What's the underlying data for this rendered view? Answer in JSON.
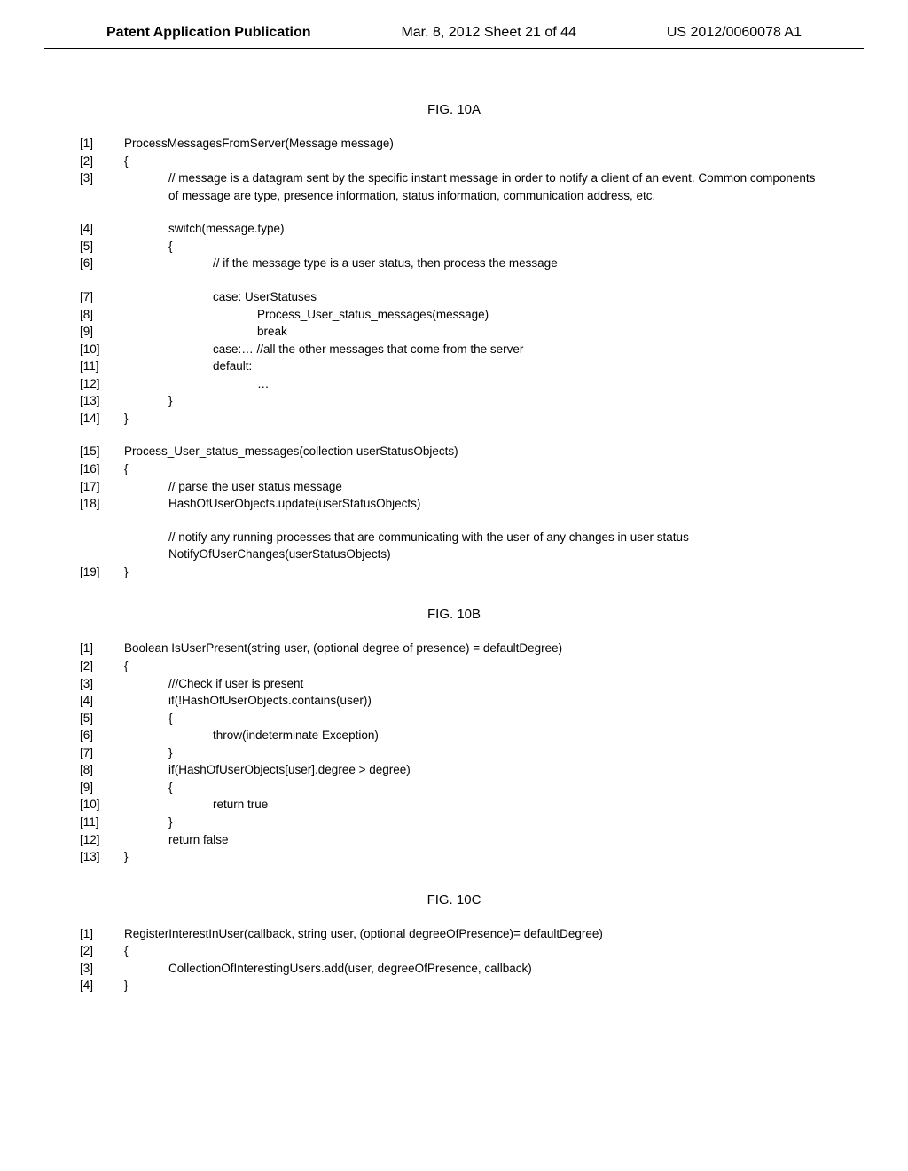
{
  "header": {
    "left": "Patent Application Publication",
    "center": "Mar. 8, 2012  Sheet 21 of 44",
    "right": "US 2012/0060078 A1"
  },
  "fig10a": {
    "title": "FIG. 10A",
    "lines": [
      {
        "num": "[1]",
        "indent": 0,
        "text": "ProcessMessagesFromServer(Message message)"
      },
      {
        "num": "[2]",
        "indent": 0,
        "text": "{"
      },
      {
        "num": "[3]",
        "indent": 1,
        "text": "// message is a datagram sent by the specific instant message in order to notify a client of an event. Common components of message are type, presence information, status information, communication address, etc."
      },
      {
        "blank": true
      },
      {
        "num": "[4]",
        "indent": 1,
        "text": "switch(message.type)"
      },
      {
        "num": "[5]",
        "indent": 1,
        "text": "{"
      },
      {
        "num": "[6]",
        "indent": 2,
        "text": "// if the message type is a user status, then process the message"
      },
      {
        "blank": true
      },
      {
        "num": "[7]",
        "indent": 2,
        "text": "case: UserStatuses"
      },
      {
        "num": "[8]",
        "indent": 3,
        "text": "Process_User_status_messages(message)"
      },
      {
        "num": "[9]",
        "indent": 3,
        "text": "break"
      },
      {
        "num": "[10]",
        "indent": 2,
        "text": "case:…  //all the other messages that come from the server"
      },
      {
        "num": "[11]",
        "indent": 2,
        "text": "default:"
      },
      {
        "num": "[12]",
        "indent": 3,
        "text": "…"
      },
      {
        "num": "[13]",
        "indent": 1,
        "text": "}"
      },
      {
        "num": "[14]",
        "indent": 0,
        "text": "}"
      },
      {
        "blank": true
      },
      {
        "num": "[15]",
        "indent": 0,
        "text": "Process_User_status_messages(collection userStatusObjects)"
      },
      {
        "num": "[16]",
        "indent": 0,
        "text": "{"
      },
      {
        "num": "[17]",
        "indent": 1,
        "text": "// parse the user status message"
      },
      {
        "num": "[18]",
        "indent": 1,
        "text": "HashOfUserObjects.update(userStatusObjects)"
      },
      {
        "blank": true
      },
      {
        "num": "",
        "indent": 1,
        "text": "// notify any running processes that are communicating with the user of any changes in user status"
      },
      {
        "num": "",
        "indent": 1,
        "text": "NotifyOfUserChanges(userStatusObjects)"
      },
      {
        "num": "[19]",
        "indent": 0,
        "text": "}"
      }
    ]
  },
  "fig10b": {
    "title": "FIG. 10B",
    "lines": [
      {
        "num": "[1]",
        "indent": 0,
        "text": "Boolean IsUserPresent(string user, (optional degree of presence) = defaultDegree)"
      },
      {
        "num": "[2]",
        "indent": 0,
        "text": "{"
      },
      {
        "num": "[3]",
        "indent": 1,
        "text": "///Check if user is present"
      },
      {
        "num": "[4]",
        "indent": 1,
        "text": "if(!HashOfUserObjects.contains(user))"
      },
      {
        "num": "[5]",
        "indent": 1,
        "text": "{"
      },
      {
        "num": "[6]",
        "indent": 2,
        "text": "throw(indeterminate Exception)"
      },
      {
        "num": "[7]",
        "indent": 1,
        "text": "}"
      },
      {
        "num": "[8]",
        "indent": 1,
        "text": "if(HashOfUserObjects[user].degree > degree)"
      },
      {
        "num": "[9]",
        "indent": 1,
        "text": "{"
      },
      {
        "num": "[10]",
        "indent": 2,
        "text": "return true"
      },
      {
        "num": "[11]",
        "indent": 1,
        "text": "}"
      },
      {
        "num": "[12]",
        "indent": 1,
        "text": "return false"
      },
      {
        "num": "[13]",
        "indent": 0,
        "text": "}"
      }
    ]
  },
  "fig10c": {
    "title": "FIG. 10C",
    "lines": [
      {
        "num": "[1]",
        "indent": 0,
        "text": "RegisterInterestInUser(callback, string user, (optional degreeOfPresence)= defaultDegree)"
      },
      {
        "num": "[2]",
        "indent": 0,
        "text": "{"
      },
      {
        "num": "[3]",
        "indent": 1,
        "text": "CollectionOfInterestingUsers.add(user, degreeOfPresence, callback)"
      },
      {
        "num": "[4]",
        "indent": 0,
        "text": "}"
      }
    ]
  }
}
